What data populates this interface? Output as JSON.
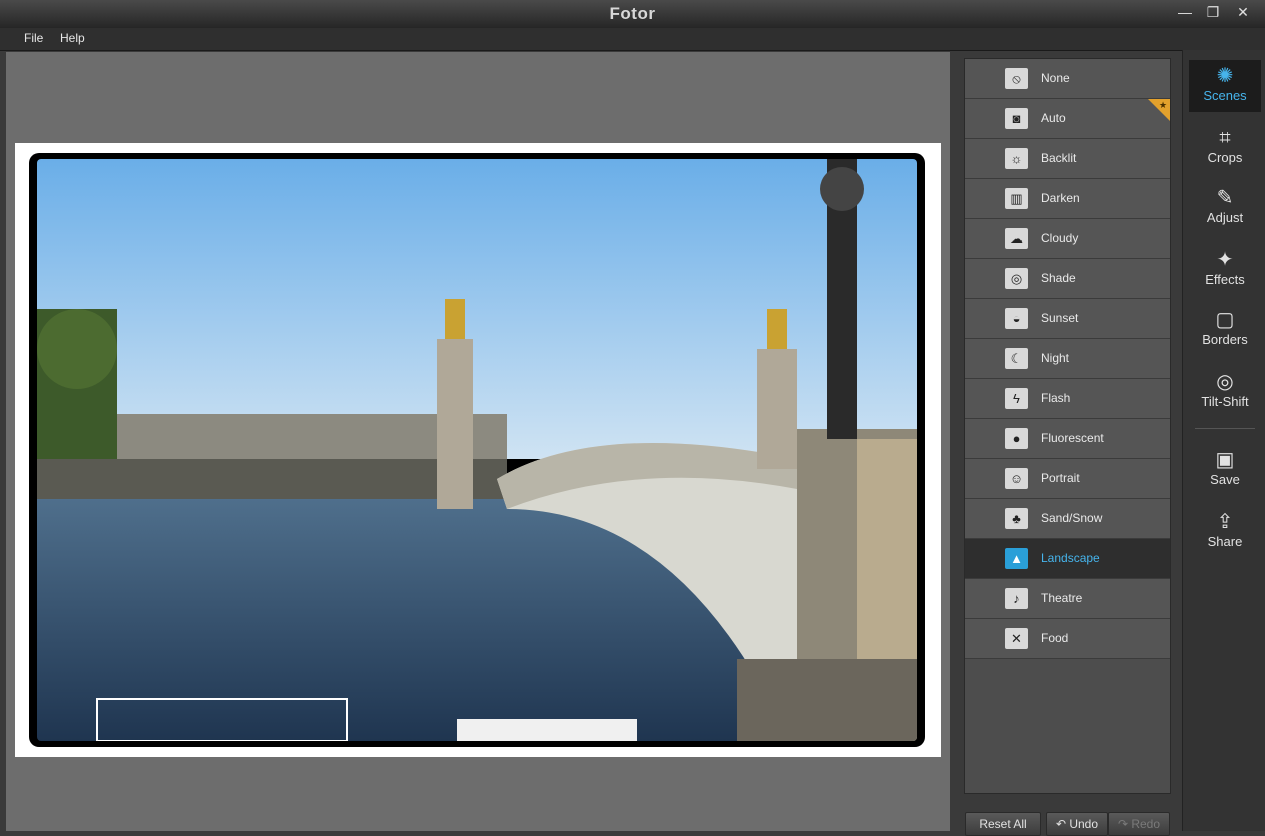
{
  "window": {
    "title": "Fotor",
    "controls": [
      "—",
      "❐",
      "✕"
    ]
  },
  "menu": [
    {
      "label": "File"
    },
    {
      "label": "Help"
    }
  ],
  "scenes": [
    {
      "label": "None",
      "icon": "⦸"
    },
    {
      "label": "Auto",
      "icon": "◙"
    },
    {
      "label": "Backlit",
      "icon": "☼"
    },
    {
      "label": "Darken",
      "icon": "▥"
    },
    {
      "label": "Cloudy",
      "icon": "☁"
    },
    {
      "label": "Shade",
      "icon": "◎"
    },
    {
      "label": "Sunset",
      "icon": "◒"
    },
    {
      "label": "Night",
      "icon": "☾"
    },
    {
      "label": "Flash",
      "icon": "ϟ"
    },
    {
      "label": "Fluorescent",
      "icon": "●"
    },
    {
      "label": "Portrait",
      "icon": "☺"
    },
    {
      "label": "Sand/Snow",
      "icon": "♣"
    },
    {
      "label": "Landscape",
      "icon": "▲"
    },
    {
      "label": "Theatre",
      "icon": "♪"
    },
    {
      "label": "Food",
      "icon": "✕"
    }
  ],
  "selected_scene": "Landscape",
  "bottom_buttons": {
    "reset": "Reset All",
    "undo": "↶ Undo",
    "redo": "↷ Redo"
  },
  "tools": [
    {
      "label": "Scenes",
      "icon": "✺"
    },
    {
      "label": "Crops",
      "icon": "⌗"
    },
    {
      "label": "Adjust",
      "icon": "✎"
    },
    {
      "label": "Effects",
      "icon": "✦"
    },
    {
      "label": "Borders",
      "icon": "▢"
    },
    {
      "label": "Tilt-Shift",
      "icon": "◎"
    }
  ],
  "actions": [
    {
      "label": "Save",
      "icon": "▣"
    },
    {
      "label": "Share",
      "icon": "⇪"
    }
  ],
  "colors": {
    "accent": "#46b4ec",
    "badge": "#e3a12c",
    "panel": "#555555"
  }
}
